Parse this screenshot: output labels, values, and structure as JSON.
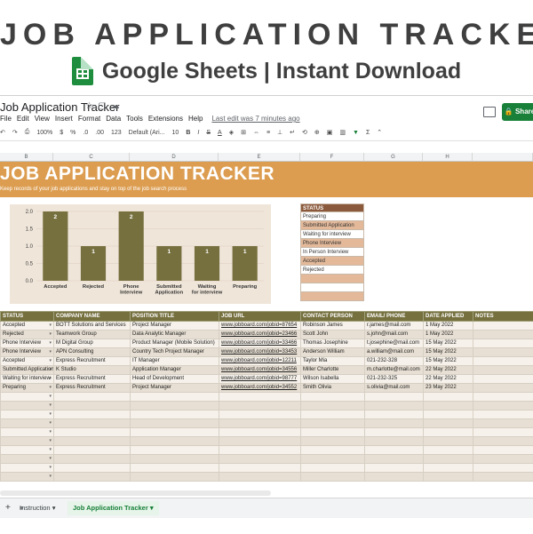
{
  "promo": {
    "title": "JOB APPLICATION TRACKER",
    "subtitle": "Google Sheets | Instant Download",
    "logo_icon": "google-sheets-icon"
  },
  "window": {
    "doc_title": "Job Application Tracker",
    "menu": [
      "File",
      "Edit",
      "View",
      "Insert",
      "Format",
      "Data",
      "Tools",
      "Extensions",
      "Help"
    ],
    "last_edit": "Last edit was 7 minutes ago",
    "share_label": "Share",
    "toolbar": {
      "zoom": "100%",
      "currency": "$",
      "percent": "%",
      "decimal_dec": ".0",
      "decimal_inc": ".00",
      "number_format": "123",
      "font": "Default (Ari...",
      "font_size": "10",
      "bold": "B",
      "italic": "I",
      "strike": "S",
      "text_color": "A"
    },
    "columns": [
      "B",
      "C",
      "D",
      "E",
      "F",
      "G",
      "H"
    ]
  },
  "sheet": {
    "banner_title": "JOB APPLICATION TRACKER",
    "banner_subtitle": "Keep records of your job applications and stay on top of the job search process",
    "banner_color": "#dc9d51"
  },
  "chart_data": {
    "type": "bar",
    "categories": [
      "Accepted",
      "Rejected",
      "Phone Interview",
      "Submitted Application",
      "Waiting for interview",
      "Preparing"
    ],
    "values": [
      2,
      1,
      2,
      1,
      1,
      1
    ],
    "ylim": [
      0,
      2.0
    ],
    "yticks": [
      "0.0",
      "0.5",
      "1.0",
      "1.5",
      "2.0"
    ],
    "bar_color": "#76703f",
    "grid": true,
    "title": "",
    "xlabel": "",
    "ylabel": ""
  },
  "status_list": {
    "header": "STATUS",
    "items": [
      "Preparing",
      "Submitted Application",
      "Waiting for interview",
      "Phone Interview",
      "In Person Interview",
      "Accepted",
      "Rejected",
      "",
      "",
      ""
    ]
  },
  "table": {
    "headers": [
      "STATUS",
      "COMPANY NAME",
      "POSITION TITLE",
      "JOB URL",
      "CONTACT PERSON",
      "EMAIL/ PHONE",
      "DATE APPLIED",
      "NOTES"
    ],
    "rows": [
      [
        "Accepted",
        "BOTT Solutions and Services",
        "Project Manager",
        "www.jobboard.com/jobid=87654",
        "Robinson James",
        "r.james@mail.com",
        "1 May 2022",
        ""
      ],
      [
        "Rejected",
        "Teamwork Group",
        "Data Analytic Manager",
        "www.jobboard.com/jobid=23466",
        "Scott John",
        "s.john@mail.com",
        "1 May 2022",
        ""
      ],
      [
        "Phone Interview",
        "M Digital Group",
        "Product Manager (Mobile Solution)",
        "www.jobboard.com/jobid=33466",
        "Thomas Josephine",
        "t.josephine@mail.com",
        "15 May 2022",
        ""
      ],
      [
        "Phone Interview",
        "APN Consulting",
        "Country Tech Project Manager",
        "www.jobboard.com/jobid=33453",
        "Anderson William",
        "a.william@mail.com",
        "15 May 2022",
        ""
      ],
      [
        "Accepted",
        "Express Recruitment",
        "IT Manager",
        "www.jobboard.com/jobid=12211",
        "Taylor Mia",
        "021-232-328",
        "15 May 2022",
        ""
      ],
      [
        "Submitted Application",
        "K Studio",
        "Application Manager",
        "www.jobboard.com/jobid=34556",
        "Miller Charlotte",
        "m.charlotte@mail.com",
        "22 May 2022",
        ""
      ],
      [
        "Waiting for interview",
        "Express Recruitment",
        "Head of Development",
        "www.jobboard.com/jobid=98777",
        "Wilson Isabella",
        "021-232-325",
        "22 May 2022",
        ""
      ],
      [
        "Preparing",
        "Express Recruitment",
        "Project Manager",
        "www.jobboard.com/jobid=34552",
        "Smith Olivia",
        "s.olivia@mail.com",
        "23 May 2022",
        ""
      ]
    ],
    "empty_rows": 10
  },
  "tabs": {
    "add_icon": "+",
    "list_icon": "≡",
    "items": [
      "Instruction",
      "Job Application Tracker"
    ],
    "active": "Job Application Tracker"
  }
}
